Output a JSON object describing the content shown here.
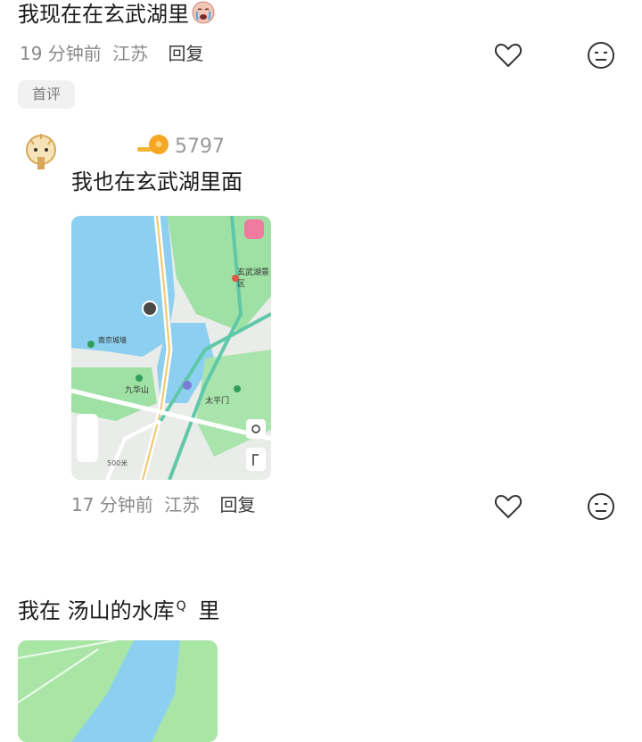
{
  "comment1": {
    "text": "我现在在玄武湖里",
    "emoji": "crying-face-emoji",
    "time": "19 分钟前",
    "location": "江苏",
    "reply": "回复",
    "first_badge": "首评"
  },
  "reply1": {
    "level_number": "5797",
    "text": "我也在玄武湖里面",
    "time": "17 分钟前",
    "location": "江苏",
    "reply": "回复",
    "map": {
      "labels": {
        "xuanwu_scenic": "玄武湖景区",
        "jiuhuashan": "九华山",
        "taiping_gate": "太平门",
        "nanjing_wall": "南京城墙",
        "scale": "500米"
      }
    }
  },
  "comment2": {
    "text_prefix": "我在",
    "text_main": "汤山的水库",
    "search_glyph": "Q",
    "text_suffix": "里"
  },
  "colors": {
    "water": "#8ccff0",
    "land": "#e9ece9",
    "park": "#9fe0a4",
    "road": "#ffffff",
    "road_teal": "#5fc8a8"
  }
}
